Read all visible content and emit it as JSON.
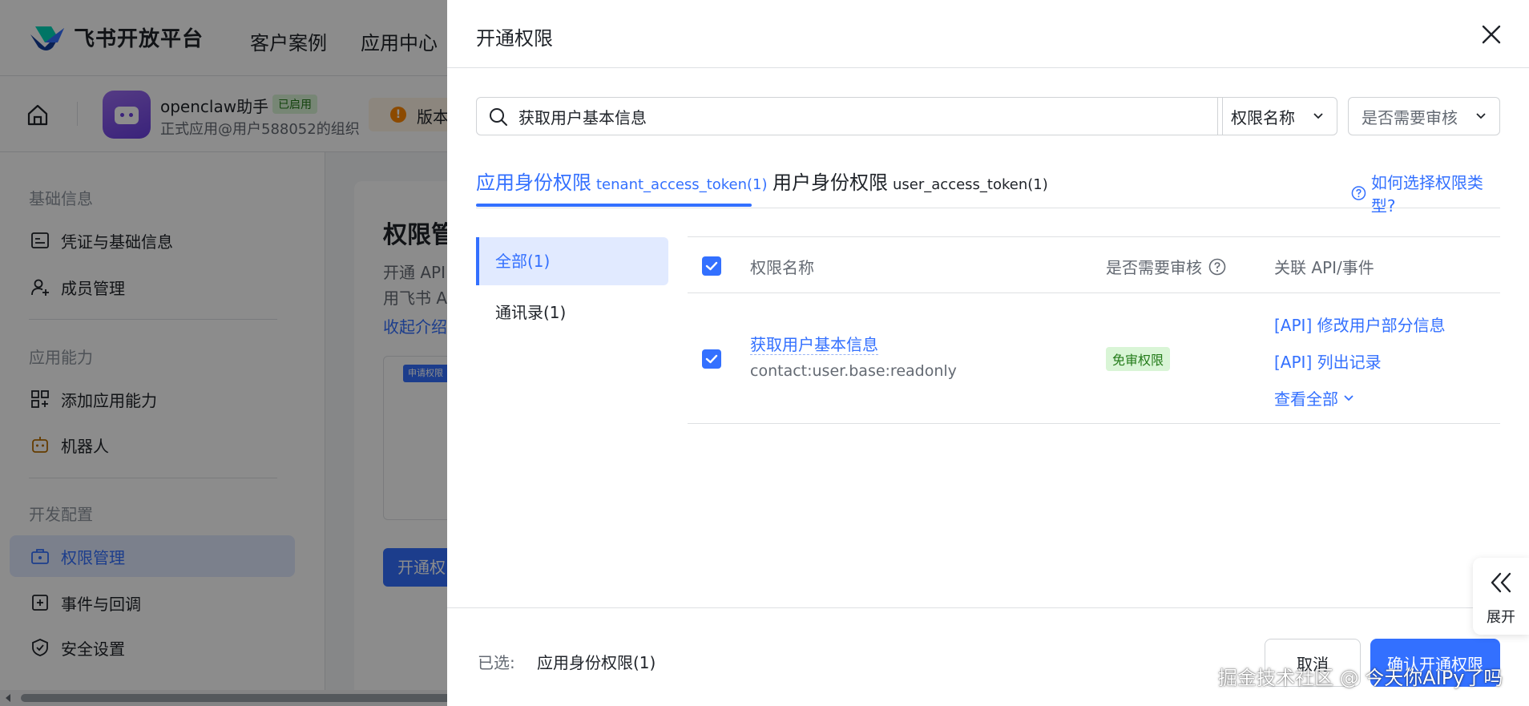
{
  "topbar": {
    "brand": "飞书开放平台",
    "nav": [
      "客户案例",
      "应用中心"
    ]
  },
  "appbar": {
    "app_name": "openclaw助手",
    "app_status": "已启用",
    "app_org": "正式应用@用户588052的组织",
    "version_text": "版本"
  },
  "sidebar": {
    "sections": [
      "基础信息",
      "应用能力",
      "开发配置"
    ],
    "items": [
      {
        "label": "凭证与基础信息",
        "icon": "id-card-icon"
      },
      {
        "label": "成员管理",
        "icon": "add-user-icon"
      },
      {
        "label": "添加应用能力",
        "icon": "grid-plus-icon"
      },
      {
        "label": "机器人",
        "icon": "robot-icon"
      },
      {
        "label": "权限管理",
        "icon": "briefcase-lock-icon"
      },
      {
        "label": "事件与回调",
        "icon": "plus-square-icon"
      },
      {
        "label": "安全设置",
        "icon": "shield-check-icon"
      }
    ]
  },
  "main": {
    "title": "权限管",
    "desc1": "开通 API",
    "desc2": "用飞书 A",
    "link": "收起介绍",
    "preview_tag": "申请权限",
    "button": "开通权"
  },
  "drawer": {
    "title": "开通权限",
    "search": {
      "value": "获取用户基本信息"
    },
    "select_name": "权限名称",
    "select_review": "是否需要审核",
    "tabs": [
      {
        "label": "应用身份权限",
        "sub": "tenant_access_token(1)",
        "active": true
      },
      {
        "label": "用户身份权限",
        "sub": "user_access_token(1)",
        "active": false
      }
    ],
    "help_link": "如何选择权限类型?",
    "categories": [
      {
        "label": "全部(1)",
        "active": true
      },
      {
        "label": "通讯录(1)",
        "active": false
      }
    ],
    "table": {
      "headers": {
        "name": "权限名称",
        "review": "是否需要审核",
        "api": "关联 API/事件"
      },
      "rows": [
        {
          "name": "获取用户基本信息",
          "code": "contact:user.base:readonly",
          "badge": "免审权限",
          "apis": [
            "[API] 修改用户部分信息",
            "[API] 列出记录"
          ],
          "more": "查看全部"
        }
      ]
    },
    "footer": {
      "selected_label": "已选:",
      "selected_value": "应用身份权限(1)",
      "cancel": "取消",
      "confirm": "确认开通权限"
    },
    "expand": "展开"
  },
  "watermark": "掘金技术社区 @ 今天你AIPy了吗",
  "colors": {
    "accent": "#3370ff",
    "badge_bg": "#d9f5d6",
    "badge_text": "#237b19"
  }
}
